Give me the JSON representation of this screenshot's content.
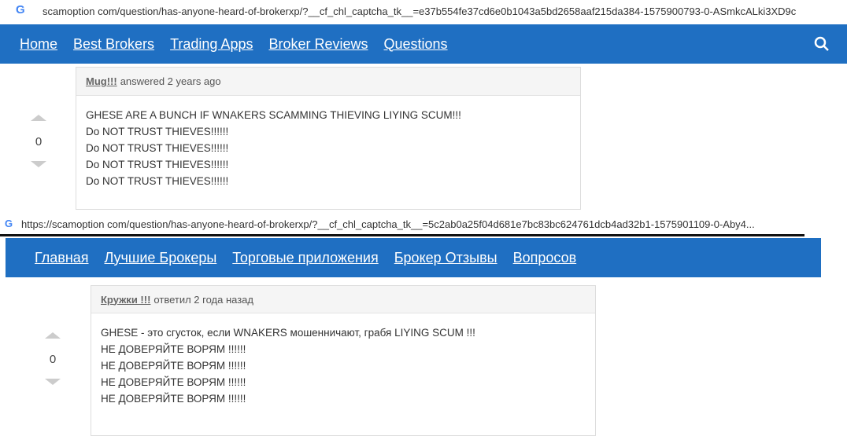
{
  "shot1": {
    "url": "scamoption com/question/has-anyone-heard-of-brokerxp/?__cf_chl_captcha_tk__=e37b554fe37cd6e0b1043a5bd2658aaf215da384-1575900793-0-ASmkcALki3XD9c",
    "nav": [
      "Home",
      "Best Brokers",
      "Trading Apps",
      "Broker Reviews",
      "Questions"
    ],
    "author": "Mug!!!",
    "meta": "answered 2 years ago",
    "votes": "0",
    "lines": [
      "GHESE ARE A BUNCH IF WNAKERS SCAMMING THIEVING LIYING SCUM!!!",
      "Do NOT TRUST THIEVES!!!!!!",
      "Do NOT TRUST THIEVES!!!!!!",
      "Do NOT TRUST THIEVES!!!!!!",
      "Do NOT TRUST THIEVES!!!!!!"
    ]
  },
  "shot2": {
    "url": "https://scamoption com/question/has-anyone-heard-of-brokerxp/?__cf_chl_captcha_tk__=5c2ab0a25f04d681e7bc83bc624761dcb4ad32b1-1575901109-0-Aby4...",
    "nav": [
      "Главная",
      "Лучшие Брокеры",
      "Торговые приложения",
      "Брокер Отзывы",
      "Вопросов"
    ],
    "author": "Кружки !!!",
    "meta": "ответил 2 года назад",
    "votes": "0",
    "lines": [
      "GHESE - это сгусток, если WNAKERS мошенничают, грабя LIYING SCUM !!!",
      "НЕ ДОВЕРЯЙТЕ ВОРЯМ !!!!!!",
      "НЕ ДОВЕРЯЙТЕ ВОРЯМ !!!!!!",
      "НЕ ДОВЕРЯЙТЕ ВОРЯМ !!!!!!",
      "НЕ ДОВЕРЯЙТЕ ВОРЯМ !!!!!!"
    ]
  }
}
